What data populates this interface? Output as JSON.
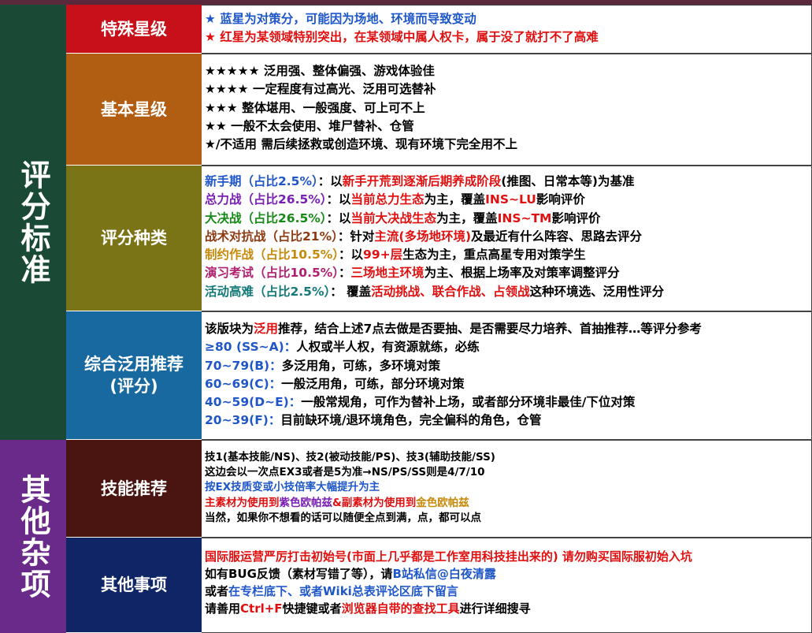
{
  "left_labels": {
    "scoring": "评分标准",
    "other": "其他杂项"
  },
  "sections": {
    "special": {
      "title": "特殊星级",
      "lines": [
        "★ 蓝星为对策分，可能因为场地、环境而导致变动",
        "★ 红星为某领域特别突出，在某领域中属人权卡，属于没了就打不了高难"
      ]
    },
    "basic": {
      "title": "基本星级",
      "lines": [
        "★★★★★ 泛用强、整体偏强、游戏体验佳",
        "★★★★ 一定程度有过高光、泛用可选替补",
        "★★★ 整体堪用、一般强度、可上可不上",
        "★★ 一般不太会使用、堆尸替补、仓管",
        "★/不适用 需后续拯救或创造环境、现有环境下完全用不上"
      ]
    },
    "types": {
      "title": "评分种类",
      "rows": [
        {
          "label": "新手期（占比2.5%）",
          "sep": "：以",
          "hl1": "新手开荒到逐渐后期养成阶段",
          "rest1": "(推图、日常本等)为基准",
          "hl2": "",
          "rest2": ""
        },
        {
          "label": "总力战（占比26.5%）",
          "sep": "：以",
          "hl1": "当前总力生态",
          "rest1": "为主，覆盖",
          "hl2": "INS~LU",
          "rest2": "影响评价"
        },
        {
          "label": "大决战（占比26.5%）",
          "sep": "：以",
          "hl1": "当前大决战生态",
          "rest1": "为主，覆盖",
          "hl2": "INS~TM",
          "rest2": "影响评价"
        },
        {
          "label": "战术对抗战（占比21%）",
          "sep": "：针对",
          "hl1": "主流(多场地环境)",
          "rest1": "及最近有什么阵容、思路去评分",
          "hl2": "",
          "rest2": ""
        },
        {
          "label": "制约作战（占比10.5%）",
          "sep": "：以",
          "hl1": "99+层",
          "rest1": "生态为主，重点高星专用对策学生",
          "hl2": "",
          "rest2": ""
        },
        {
          "label": "演习考试（占比10.5%）",
          "sep": "：",
          "hl1": "三场地主环境",
          "rest1": "为主、根据上场率及对策率调整评分",
          "hl2": "",
          "rest2": ""
        },
        {
          "label": "活动高难（占比2.5%）",
          "sep": "： 覆盖",
          "hl1": "活动挑战、联合作战、占领战",
          "rest1": "这种环境选、泛用性评分",
          "hl2": "",
          "rest2": ""
        }
      ]
    },
    "recommend": {
      "title": "综合泛用推荐",
      "subtitle": "(评分)",
      "intro_a": "该版块为",
      "intro_hl": "泛用",
      "intro_b": "推荐，结合上述7点去做是否要抽、是否需要尽力培养、首抽推荐…等评分参考",
      "rows": [
        {
          "label": "≥80 (SS~A)：",
          "text": "人权或半人权，有资源就练，必练"
        },
        {
          "label": "70~79(B)：",
          "text": "多泛用角，可练，多环境对策"
        },
        {
          "label": "60~69(C)：",
          "text": "一般泛用角，可练，部分环境对策"
        },
        {
          "label": "40~59(D~E)：",
          "text": "一般常规角，可作为替补上场，或者部分环境非最佳/下位对策"
        },
        {
          "label": "20~39(F)：",
          "text": "目前缺环境/退环境角色，完全偏科的角色，仓管"
        }
      ]
    },
    "skill": {
      "title": "技能推荐",
      "line1": "技1(基本技能/NS)、技2(被动技能/PS)、技3(辅助技能/SS)",
      "line2": "这边会以一次点EX3或者是5为准→NS/PS/SS则是4/7/10",
      "line3": "按EX技质变或小技倍率大幅提升为主",
      "line4a": "主素材为使用到",
      "line4b": "紫色欧帕兹",
      "line4c": "&副素材为使用到",
      "line4d": "金色欧帕兹",
      "line5": "当然，如果你不想看的话可以随便全点到满，点，都可以点"
    },
    "other": {
      "title": "其他事项",
      "line1": "国际服运营严厉打击初始号(市面上几乎都是工作室用科技挂出来的) 请勿购买国际服初始入坑",
      "line2a": "如有BUG反馈（素材写错了等），请",
      "line2b": "B站私信@白夜清露",
      "line3a": "或者",
      "line3b": "在专栏底下、或者Wiki总表评论区底下留言",
      "line4a": "请善用",
      "line4b": "Ctrl+F",
      "line4c": "快捷键或者",
      "line4d": "浏览器自带的查找工具",
      "line4e": "进行详细搜寻"
    }
  },
  "colors": {
    "left_scoring": "#1a4a35",
    "left_other": "#6a2a8a",
    "special": "#c8101a",
    "basic": "#b25e12",
    "types": "#7a7416",
    "recommend": "#1869a0",
    "skill": "#4a1410",
    "other": "#102566"
  }
}
